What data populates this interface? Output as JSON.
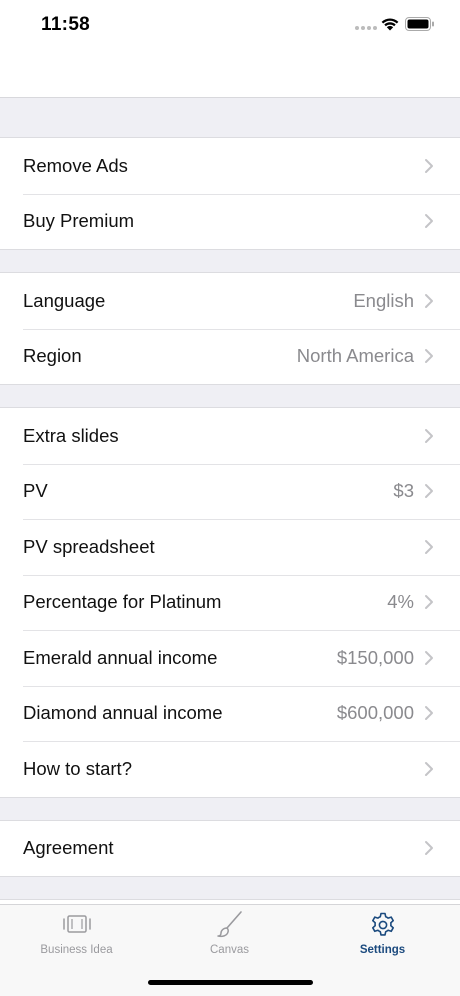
{
  "status_bar": {
    "time": "11:58"
  },
  "settings": {
    "groups": [
      {
        "rows": [
          {
            "label": "Remove Ads",
            "value": ""
          },
          {
            "label": "Buy Premium",
            "value": ""
          }
        ]
      },
      {
        "rows": [
          {
            "label": "Language",
            "value": "English"
          },
          {
            "label": "Region",
            "value": "North America"
          }
        ]
      },
      {
        "rows": [
          {
            "label": "Extra slides",
            "value": ""
          },
          {
            "label": "PV",
            "value": "$3"
          },
          {
            "label": "PV spreadsheet",
            "value": ""
          },
          {
            "label": "Percentage for Platinum",
            "value": "4%"
          },
          {
            "label": "Emerald annual income",
            "value": "$150,000"
          },
          {
            "label": "Diamond annual income",
            "value": "$600,000"
          },
          {
            "label": "How to start?",
            "value": ""
          }
        ]
      },
      {
        "rows": [
          {
            "label": "Agreement",
            "value": ""
          }
        ]
      }
    ]
  },
  "tab_bar": {
    "tabs": [
      {
        "label": "Business Idea",
        "icon": "slides-icon",
        "active": false
      },
      {
        "label": "Canvas",
        "icon": "brush-icon",
        "active": false
      },
      {
        "label": "Settings",
        "icon": "gear-icon",
        "active": true
      }
    ]
  },
  "colors": {
    "accent": "#1b4a7e",
    "secondary_text": "#8a8a8e",
    "group_background": "#efeff4"
  }
}
